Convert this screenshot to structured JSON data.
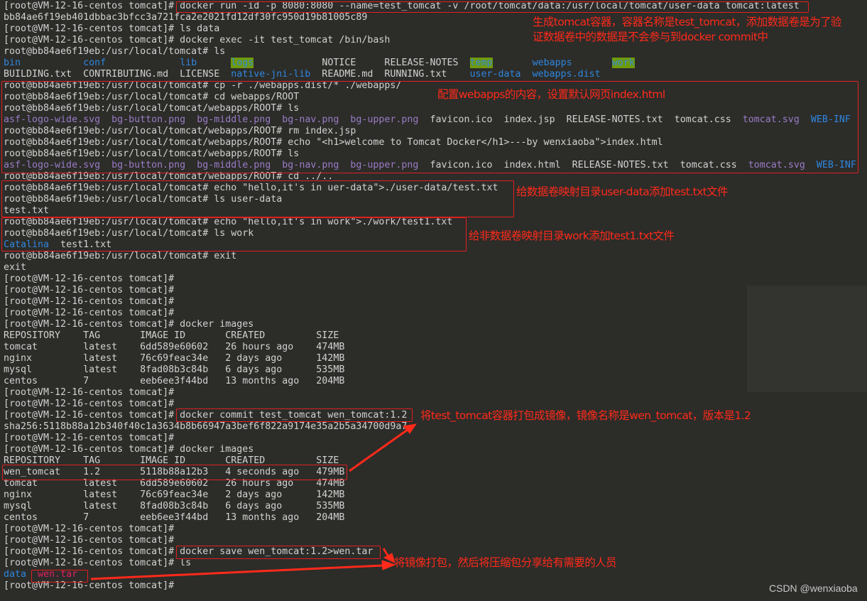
{
  "colors": {
    "background": "#2c2c29",
    "text": "#d2d2d2",
    "directory": "#2f86de",
    "image_file": "#9a7cc6",
    "archive": "#e3205e",
    "highlight_bg": "#6f9a0c",
    "annotation": "#ff2a1a"
  },
  "terminal": {
    "lines": [
      [
        {
          "t": "[root@VM-12-16-centos tomcat]# docker run -id -p 8080:8080 --name=test_tomcat -v /root/tomcat/data:/usr/local/tomcat/user-data tomcat:latest"
        }
      ],
      [
        {
          "t": "bb84ae6f19eb401dbbac3bfcc3a721fca2e2021fd12df30fc950d19b81005c89"
        }
      ],
      [
        {
          "t": "[root@VM-12-16-centos tomcat]# ls data"
        }
      ],
      [
        {
          "t": "[root@VM-12-16-centos tomcat]# docker exec -it test_tomcat /bin/bash"
        }
      ],
      [
        {
          "t": "root@bb84ae6f19eb:/usr/local/tomcat# ls"
        }
      ],
      [
        {
          "t": "bin",
          "c": "blue"
        },
        {
          "t": "           "
        },
        {
          "t": "conf",
          "c": "blue"
        },
        {
          "t": "             "
        },
        {
          "t": "lib",
          "c": "blue"
        },
        {
          "t": "      "
        },
        {
          "t": "logs",
          "c": "hl"
        },
        {
          "t": "            NOTICE     RELEASE-NOTES  "
        },
        {
          "t": "temp",
          "c": "hl"
        },
        {
          "t": "       "
        },
        {
          "t": "webapps",
          "c": "blue"
        },
        {
          "t": "       "
        },
        {
          "t": "work",
          "c": "hl"
        }
      ],
      [
        {
          "t": "BUILDING.txt  CONTRIBUTING.md  LICENSE  "
        },
        {
          "t": "native-jni-lib",
          "c": "blue"
        },
        {
          "t": "  README.md  RUNNING.txt    "
        },
        {
          "t": "user-data",
          "c": "blue"
        },
        {
          "t": "  "
        },
        {
          "t": "webapps.dist",
          "c": "blue"
        }
      ],
      [
        {
          "t": "root@bb84ae6f19eb:/usr/local/tomcat# cp -r ./webapps.dist/* ./webapps/"
        }
      ],
      [
        {
          "t": "root@bb84ae6f19eb:/usr/local/tomcat# cd webapps/ROOT"
        }
      ],
      [
        {
          "t": "root@bb84ae6f19eb:/usr/local/tomcat/webapps/ROOT# ls"
        }
      ],
      [
        {
          "t": "asf-logo-wide.svg",
          "c": "purple"
        },
        {
          "t": "  "
        },
        {
          "t": "bg-button.png",
          "c": "purple"
        },
        {
          "t": "  "
        },
        {
          "t": "bg-middle.png",
          "c": "purple"
        },
        {
          "t": "  "
        },
        {
          "t": "bg-nav.png",
          "c": "purple"
        },
        {
          "t": "  "
        },
        {
          "t": "bg-upper.png",
          "c": "purple"
        },
        {
          "t": "  favicon.ico  index.jsp  RELEASE-NOTES.txt  tomcat.css  "
        },
        {
          "t": "tomcat.svg",
          "c": "purple"
        },
        {
          "t": "  "
        },
        {
          "t": "WEB-INF",
          "c": "blue"
        }
      ],
      [
        {
          "t": "root@bb84ae6f19eb:/usr/local/tomcat/webapps/ROOT# rm index.jsp"
        }
      ],
      [
        {
          "t": "root@bb84ae6f19eb:/usr/local/tomcat/webapps/ROOT# echo \"<h1>welcome to Tomcat Docker</h1>---by wenxiaoba\">index.html"
        }
      ],
      [
        {
          "t": "root@bb84ae6f19eb:/usr/local/tomcat/webapps/ROOT# ls"
        }
      ],
      [
        {
          "t": "asf-logo-wide.svg",
          "c": "purple"
        },
        {
          "t": "  "
        },
        {
          "t": "bg-button.png",
          "c": "purple"
        },
        {
          "t": "  "
        },
        {
          "t": "bg-middle.png",
          "c": "purple"
        },
        {
          "t": "  "
        },
        {
          "t": "bg-nav.png",
          "c": "purple"
        },
        {
          "t": "  "
        },
        {
          "t": "bg-upper.png",
          "c": "purple"
        },
        {
          "t": "  favicon.ico  index.html  RELEASE-NOTES.txt  tomcat.css  "
        },
        {
          "t": "tomcat.svg",
          "c": "purple"
        },
        {
          "t": "  "
        },
        {
          "t": "WEB-INF",
          "c": "blue"
        }
      ],
      [
        {
          "t": "root@bb84ae6f19eb:/usr/local/tomcat/webapps/ROOT# cd ../.."
        }
      ],
      [
        {
          "t": "root@bb84ae6f19eb:/usr/local/tomcat# echo \"hello,it's in uer-data\">./user-data/test.txt"
        }
      ],
      [
        {
          "t": "root@bb84ae6f19eb:/usr/local/tomcat# ls user-data"
        }
      ],
      [
        {
          "t": "test.txt"
        }
      ],
      [
        {
          "t": "root@bb84ae6f19eb:/usr/local/tomcat# echo \"hello,it's in work\">./work/test1.txt"
        }
      ],
      [
        {
          "t": "root@bb84ae6f19eb:/usr/local/tomcat# ls work"
        }
      ],
      [
        {
          "t": "Catalina",
          "c": "blue"
        },
        {
          "t": "  test1.txt"
        }
      ],
      [
        {
          "t": "root@bb84ae6f19eb:/usr/local/tomcat# exit"
        }
      ],
      [
        {
          "t": "exit"
        }
      ],
      [
        {
          "t": "[root@VM-12-16-centos tomcat]#"
        }
      ],
      [
        {
          "t": "[root@VM-12-16-centos tomcat]#"
        }
      ],
      [
        {
          "t": "[root@VM-12-16-centos tomcat]#"
        }
      ],
      [
        {
          "t": "[root@VM-12-16-centos tomcat]#"
        }
      ],
      [
        {
          "t": "[root@VM-12-16-centos tomcat]# docker images"
        }
      ],
      [
        {
          "t": "REPOSITORY    TAG       IMAGE ID       CREATED         SIZE"
        }
      ],
      [
        {
          "t": "tomcat        latest    6dd589e60602   26 hours ago    474MB"
        }
      ],
      [
        {
          "t": "nginx         latest    76c69feac34e   2 days ago      142MB"
        }
      ],
      [
        {
          "t": "mysql         latest    8fad08b3c84b   6 days ago      535MB"
        }
      ],
      [
        {
          "t": "centos        7         eeb6ee3f44bd   13 months ago   204MB"
        }
      ],
      [
        {
          "t": "[root@VM-12-16-centos tomcat]#"
        }
      ],
      [
        {
          "t": "[root@VM-12-16-centos tomcat]#"
        }
      ],
      [
        {
          "t": "[root@VM-12-16-centos tomcat]# docker commit test_tomcat wen_tomcat:1.2"
        }
      ],
      [
        {
          "t": "sha256:5118b88a12b340f40c1a3634b8b66947a3bef6f822a9174e35a2b5a34700d9a7"
        }
      ],
      [
        {
          "t": "[root@VM-12-16-centos tomcat]#"
        }
      ],
      [
        {
          "t": "[root@VM-12-16-centos tomcat]# docker images"
        }
      ],
      [
        {
          "t": "REPOSITORY    TAG       IMAGE ID       CREATED         SIZE"
        }
      ],
      [
        {
          "t": "wen_tomcat    1.2       5118b88a12b3   4 seconds ago   479MB"
        }
      ],
      [
        {
          "t": "tomcat        latest    6dd589e60602   26 hours ago    474MB"
        }
      ],
      [
        {
          "t": "nginx         latest    76c69feac34e   2 days ago      142MB"
        }
      ],
      [
        {
          "t": "mysql         latest    8fad08b3c84b   6 days ago      535MB"
        }
      ],
      [
        {
          "t": "centos        7         eeb6ee3f44bd   13 months ago   204MB"
        }
      ],
      [
        {
          "t": "[root@VM-12-16-centos tomcat]#"
        }
      ],
      [
        {
          "t": "[root@VM-12-16-centos tomcat]#"
        }
      ],
      [
        {
          "t": "[root@VM-12-16-centos tomcat]# docker save wen_tomcat:1.2>wen.tar"
        }
      ],
      [
        {
          "t": "[root@VM-12-16-centos tomcat]# ls"
        }
      ],
      [
        {
          "t": "data",
          "c": "blue"
        },
        {
          "t": "  "
        },
        {
          "t": "wen.tar",
          "c": "red"
        }
      ],
      [
        {
          "t": "[root@VM-12-16-centos tomcat]#"
        }
      ]
    ]
  },
  "annotations": {
    "run_note_line1": "生成tomcat容器，容器名称是test_tomcat，添加数据卷是为了验",
    "run_note_line2": "证数据卷中的数据是不会参与到docker commit中",
    "webapps_note": "配置webapps的内容，设置默认网页index.html",
    "user_data_note": "给数据卷映射目录user-data添加test.txt文件",
    "work_note": "给非数据卷映射目录work添加test1.txt文件",
    "commit_note": "将test_tomcat容器打包成镜像，镜像名称是wen_tomcat，版本是1.2",
    "save_note": "将镜像打包，然后将压缩包分享给有需要的人员"
  },
  "watermark": "CSDN @wenxiaoba"
}
